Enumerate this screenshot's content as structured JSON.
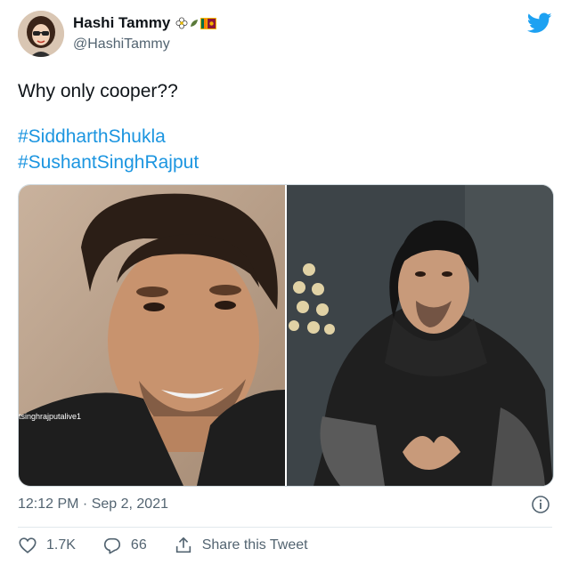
{
  "user": {
    "display_name": "Hashi Tammy",
    "handle": "@HashiTammy",
    "avatar_icon": "avatar-cartoon-girl",
    "name_emojis": [
      "flower-icon",
      "sri-lanka-flag-icon"
    ]
  },
  "tweet": {
    "text": "Why only cooper??",
    "hashtags": [
      "#SiddharthShukla",
      "#SushantSinghRajput"
    ],
    "media": {
      "left_photo_watermark": "tsinghrajputalive1",
      "left_photo": "portrait-man-smiling",
      "right_photo": "portrait-man-black-hoodie"
    },
    "timestamp": "12:12 PM · Sep 2, 2021"
  },
  "actions": {
    "likes": "1.7K",
    "replies": "66",
    "share_label": "Share this Tweet"
  },
  "colors": {
    "brand": "#1da1f2",
    "hashtag": "#1b95e0",
    "secondary_text": "#536471"
  }
}
